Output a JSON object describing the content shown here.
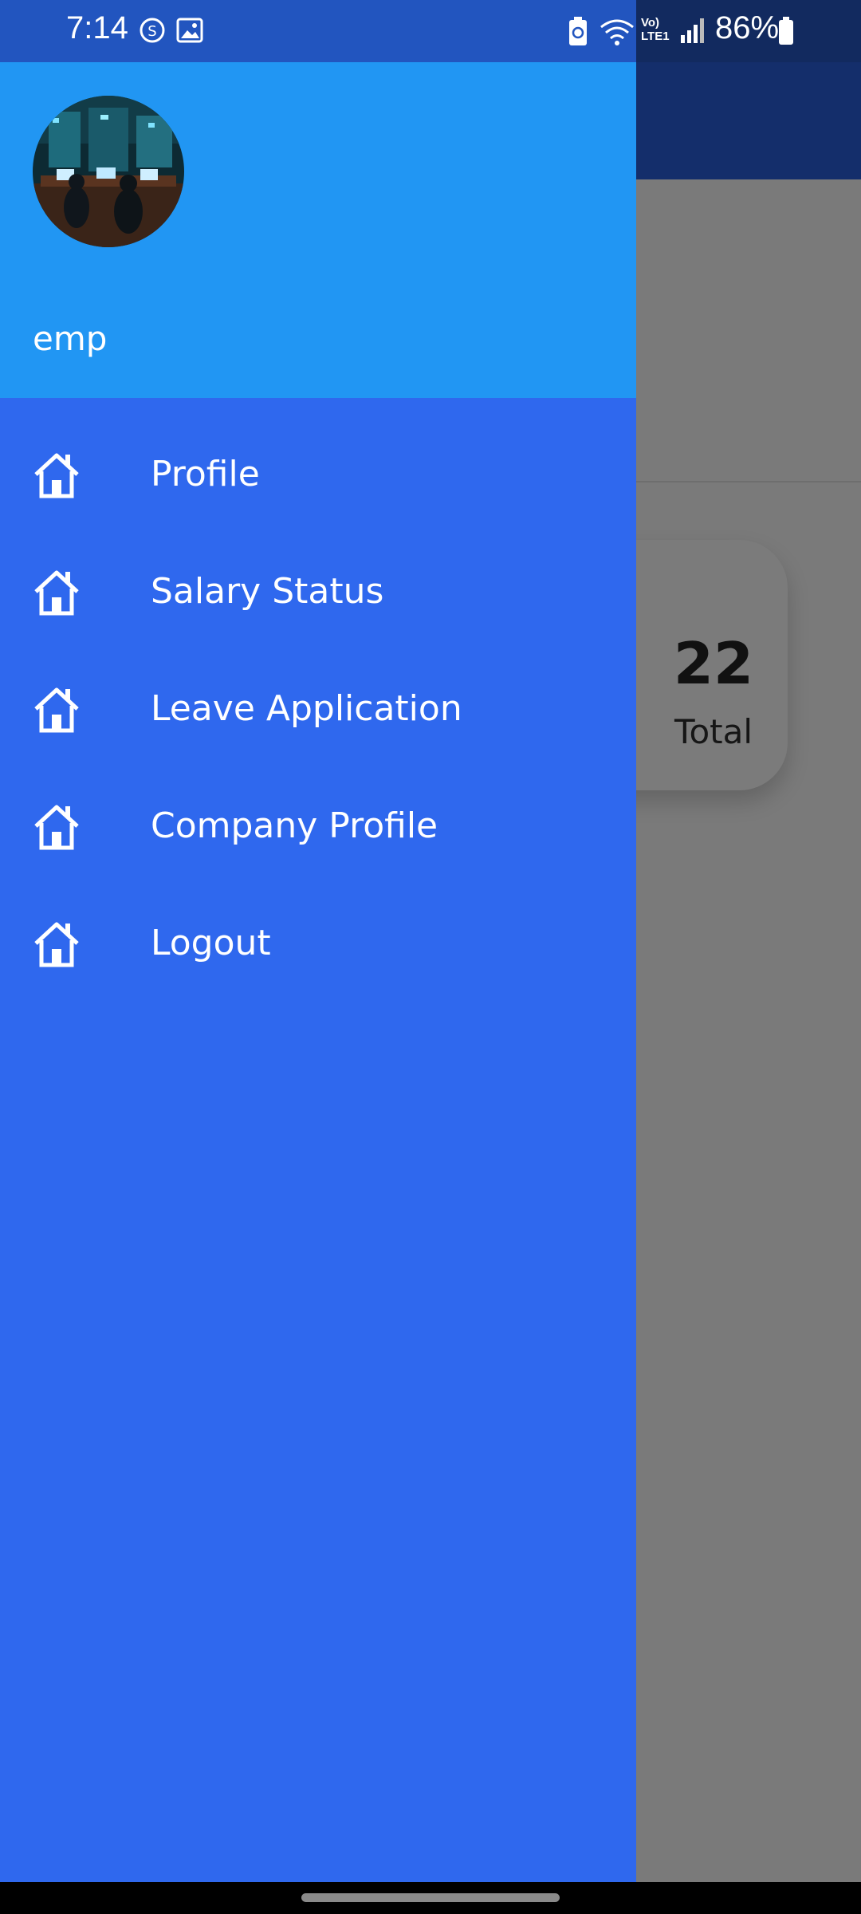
{
  "status_bar": {
    "time": "7:14",
    "battery": "86%",
    "network_label": "Vo) LTE1"
  },
  "drawer": {
    "username": "emp",
    "menu_items": [
      {
        "label": "Profile",
        "icon": "home-icon"
      },
      {
        "label": "Salary Status",
        "icon": "home-icon"
      },
      {
        "label": "Leave Application",
        "icon": "home-icon"
      },
      {
        "label": "Company Profile",
        "icon": "home-icon"
      },
      {
        "label": "Logout",
        "icon": "home-icon"
      }
    ]
  },
  "background": {
    "card_count": "22",
    "card_label": "Total"
  },
  "colors": {
    "drawer_header": "#2196f3",
    "drawer_body": "#2f68ee",
    "app_bar": "#142e6b",
    "scrim": "#787878"
  }
}
